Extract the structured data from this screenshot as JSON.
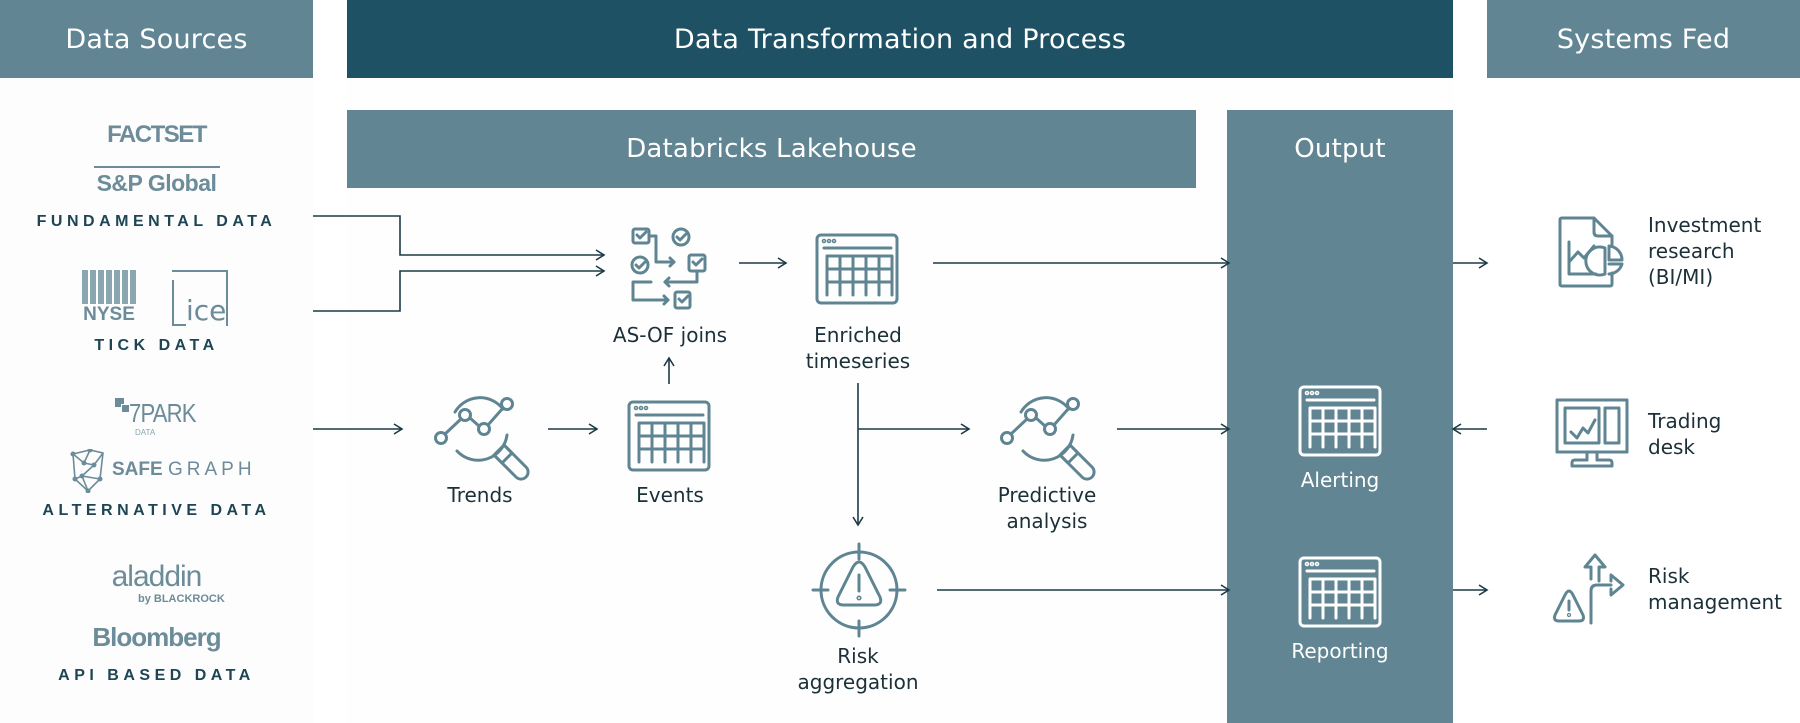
{
  "headers": {
    "data_sources": "Data Sources",
    "transformation": "Data Transformation and Process",
    "systems_fed": "Systems Fed"
  },
  "sub_headers": {
    "lakehouse": "Databricks Lakehouse",
    "output": "Output"
  },
  "data_sources": {
    "fundamental": {
      "logos": [
        "FACTSET",
        "S&P Global"
      ],
      "label": "FUNDAMENTAL DATA"
    },
    "tick": {
      "logos": [
        "NYSE",
        "ice"
      ],
      "label": "TICK DATA"
    },
    "alternative": {
      "logos": [
        "7PARK",
        "DATA",
        "SAFE",
        "GRAPH"
      ],
      "label": "ALTERNATIVE DATA"
    },
    "api": {
      "logos": [
        "aladdin",
        "by BLACKROCK",
        "Bloomberg"
      ],
      "label": "API BASED DATA"
    }
  },
  "process_nodes": {
    "asof_joins": {
      "label": "AS-OF joins",
      "icon": "workflow-checklist-icon"
    },
    "enriched_timeseries": {
      "label_line1": "Enriched",
      "label_line2": "timeseries",
      "icon": "table-icon"
    },
    "trends": {
      "label": "Trends",
      "icon": "search-analytics-icon"
    },
    "events": {
      "label": "Events",
      "icon": "table-icon"
    },
    "predictive_analysis": {
      "label_line1": "Predictive",
      "label_line2": "analysis",
      "icon": "search-analytics-icon"
    },
    "risk_aggregation": {
      "label_line1": "Risk",
      "label_line2": "aggregation",
      "icon": "target-warning-icon"
    }
  },
  "output_nodes": {
    "alerting": {
      "label": "Alerting",
      "icon": "table-icon"
    },
    "reporting": {
      "label": "Reporting",
      "icon": "table-icon"
    }
  },
  "systems_fed": {
    "investment_research": {
      "line1": "Investment",
      "line2": "research",
      "line3": "(BI/MI)",
      "icon": "report-chart-icon"
    },
    "trading_desk": {
      "line1": "Trading",
      "line2": "desk",
      "icon": "monitor-chart-icon"
    },
    "risk_management": {
      "line1": "Risk",
      "line2": "management",
      "icon": "split-arrows-warning-icon"
    }
  },
  "colors": {
    "header_dark": "#1d5163",
    "header_mid": "#618593",
    "icon_stroke": "#5f8593",
    "arrow": "#1d3a46",
    "text": "#1b3038"
  }
}
